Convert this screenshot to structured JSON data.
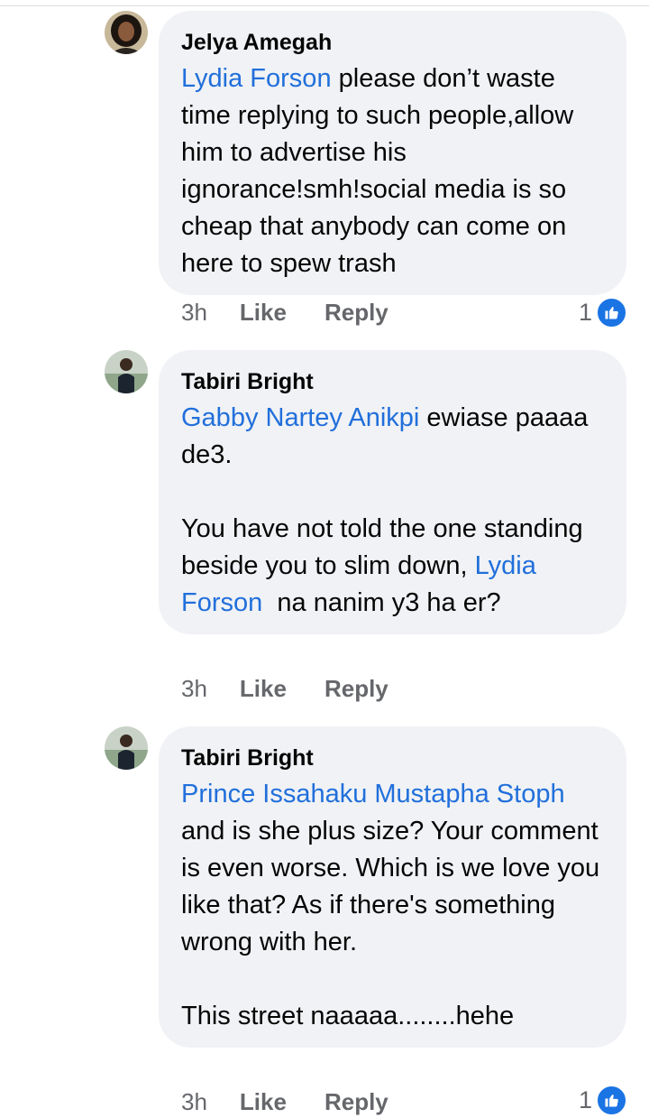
{
  "comments": [
    {
      "author": "Jelya Amegah",
      "mention": "Lydia Forson",
      "text": " please don’t waste time replying to such people,allow him to advertise his ignorance!smh!social media is so cheap that anybody can come on here to spew trash",
      "time": "3h",
      "like_label": "Like",
      "reply_label": "Reply",
      "reaction_count": "1"
    },
    {
      "author": "Tabiri Bright",
      "mention": "Gabby Nartey Anikpi",
      "text": " ewiase paaaa de3.",
      "para2_pre": "You have not told the one standing beside you to slim down, ",
      "para2_mention": "Lydia Forson",
      "para2_post": "  na nanim y3 ha er?",
      "time": "3h",
      "like_label": "Like",
      "reply_label": "Reply"
    },
    {
      "author": "Tabiri Bright",
      "mention": "Prince Issahaku Mustapha Stoph",
      "text": " and is she plus size? Your comment is even worse. Which is we love you like that? As if there's something wrong with her.",
      "para2": "This street naaaaa........hehe",
      "time": "3h",
      "like_label": "Like",
      "reply_label": "Reply",
      "reaction_count": "1"
    }
  ],
  "colors": {
    "mention": "#216fdb",
    "bubble": "#f0f2f5",
    "meta": "#65676b",
    "like_badge": "#1b74e4"
  },
  "icons": {
    "reaction": "thumbs-up-icon"
  }
}
